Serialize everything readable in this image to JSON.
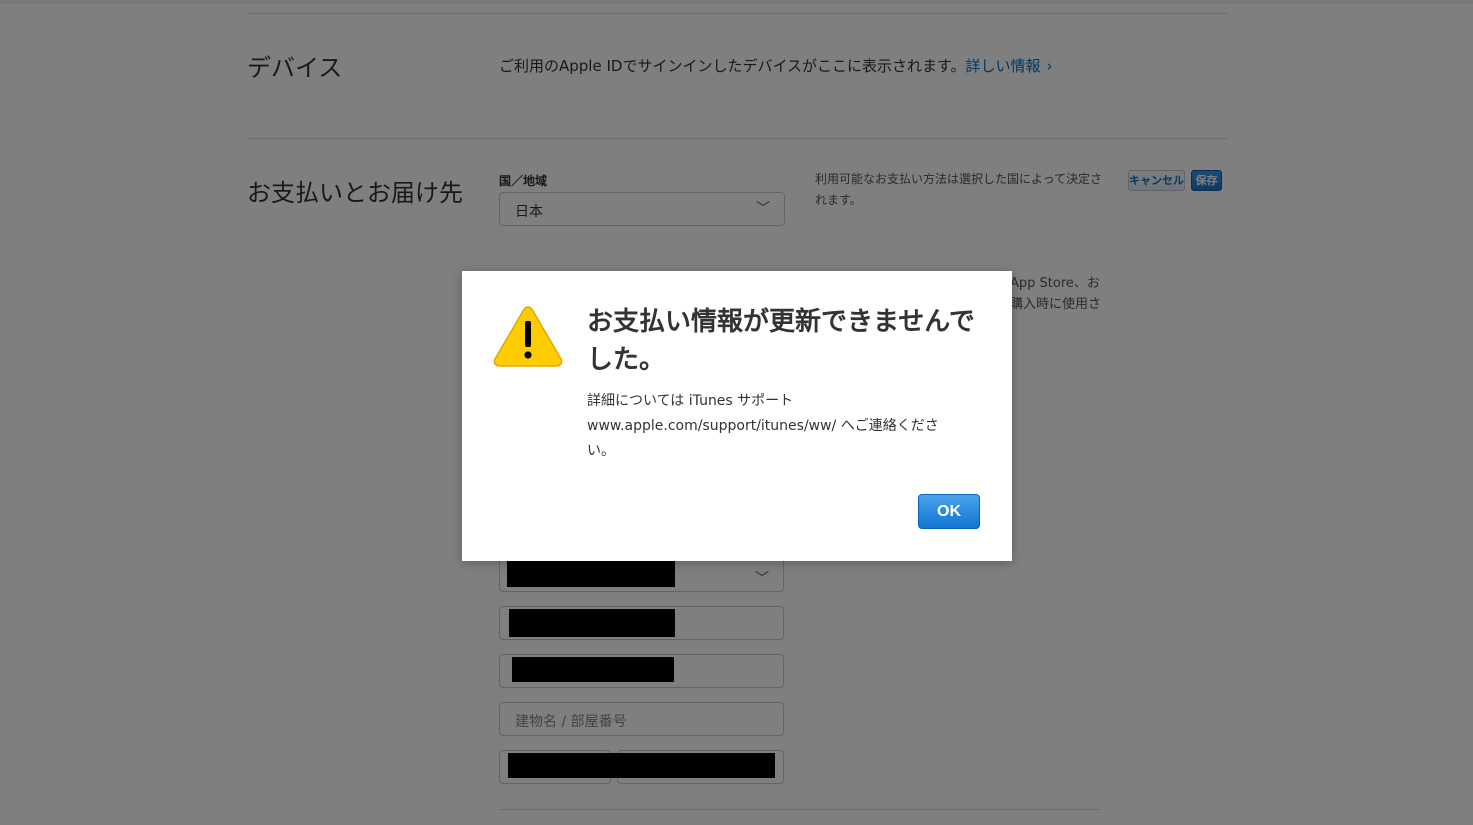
{
  "devices": {
    "section_title": "デバイス",
    "description": "ご利用のApple IDでサインインしたデバイスがここに表示されます。",
    "link_label": "詳しい情報",
    "link_chevron": "›"
  },
  "payment": {
    "section_title": "お支払いとお届け先",
    "country_label": "国／地域",
    "country_value": "日本",
    "country_note_line1": "利用可能なお支払い方法は選択した国によって決定さ",
    "country_note_line2": "れます。",
    "partial_note_line1": "App Store、お",
    "partial_note_line2": "購入時に使用さ",
    "cancel_label": "キャンセル",
    "save_label": "保存",
    "building_placeholder": "建物名 / 部屋番号",
    "select_chevron": "﹀"
  },
  "dialog": {
    "title": "お支払い情報が更新できませんでした。",
    "body_line1": "詳細については iTunes サポート",
    "body_line2": "www.apple.com/support/itunes/ww/ へご連絡くださ",
    "body_line3": "い。",
    "ok_label": "OK",
    "icon": "warning-icon",
    "icon_color": "#ffcc00"
  },
  "colors": {
    "link": "#0070c9",
    "overlay": "rgba(0,0,0,0.5)"
  }
}
